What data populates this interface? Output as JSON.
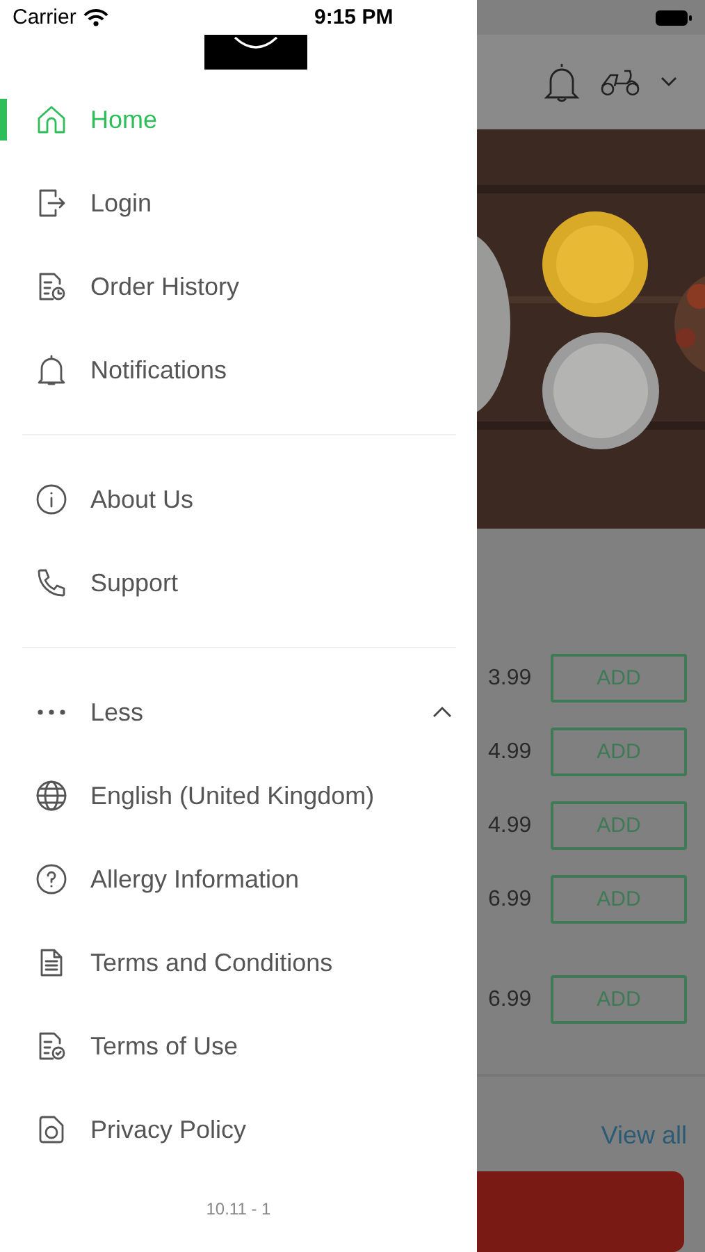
{
  "status_bar": {
    "carrier": "Carrier",
    "time": "9:15 PM"
  },
  "menu": {
    "groups": [
      {
        "items": [
          {
            "label": "Home",
            "selected": true
          },
          {
            "label": "Login",
            "selected": false
          },
          {
            "label": "Order History",
            "selected": false
          },
          {
            "label": "Notifications",
            "selected": false
          }
        ]
      },
      {
        "items": [
          {
            "label": "About Us",
            "selected": false
          },
          {
            "label": "Support",
            "selected": false
          }
        ]
      }
    ],
    "more_toggle": {
      "label": "Less",
      "expanded": true
    },
    "more_items": [
      {
        "label": "English (United Kingdom)",
        "selected": false
      },
      {
        "label": "Allergy Information",
        "selected": false
      },
      {
        "label": "Terms and Conditions",
        "selected": false
      },
      {
        "label": "Terms of Use",
        "selected": false
      },
      {
        "label": "Privacy Policy",
        "selected": false
      }
    ],
    "version": "10.11 - 1"
  },
  "background": {
    "products": [
      {
        "price": "3.99",
        "button": "ADD"
      },
      {
        "price": "4.99",
        "button": "ADD"
      },
      {
        "price": "4.99",
        "button": "ADD"
      },
      {
        "price": "6.99",
        "button": "ADD"
      },
      {
        "price": "6.99",
        "button": "ADD"
      }
    ],
    "view_all": "View all"
  }
}
